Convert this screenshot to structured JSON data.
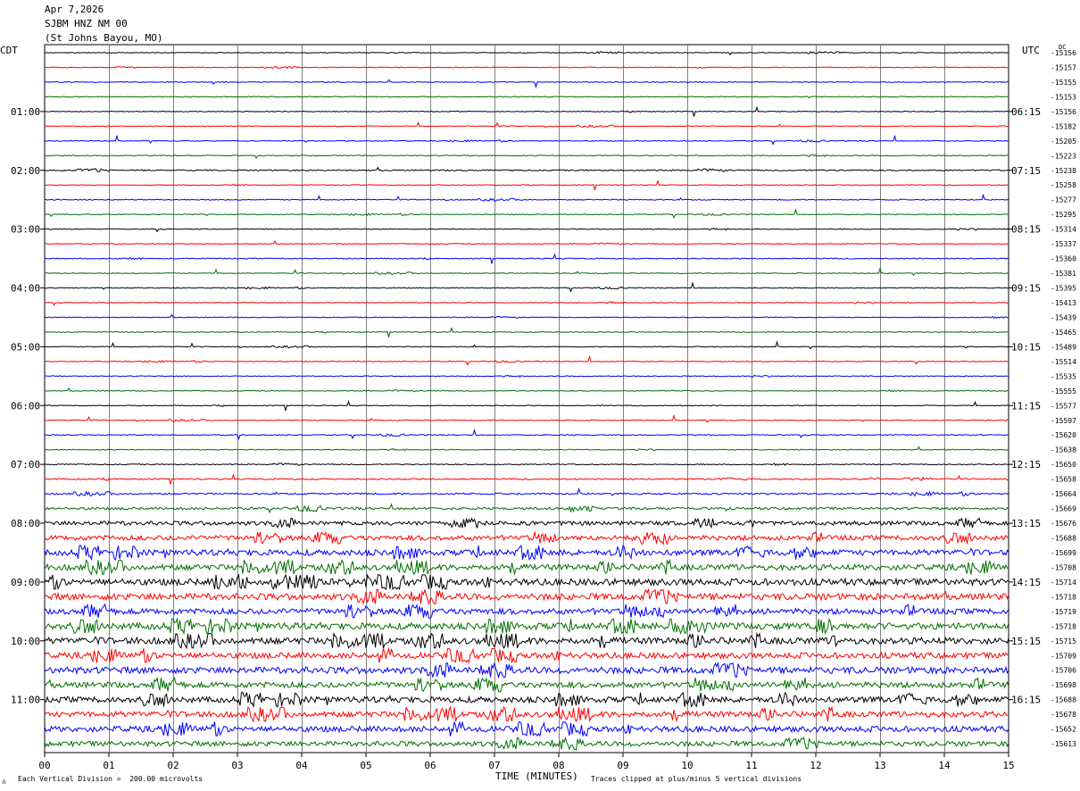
{
  "header": {
    "date": "Apr 7,2026",
    "station": "SJBM HNZ NM 00",
    "location": "(St Johns Bayou, MO)"
  },
  "left_axis_label": "CDT",
  "right_axis_label": "UTC",
  "dc_label": "DC",
  "footer": {
    "scale_note": "Each Vertical Division =  200.00 microvolts",
    "xlabel": "TIME (MINUTES)",
    "clip_note": "Traces clipped at plus/minus 5 vertical divisions"
  },
  "colors": {
    "trace_cycle": [
      "#000000",
      "#ff0000",
      "#0000ff",
      "#007000"
    ],
    "gridline": "#808080"
  },
  "chart_data": {
    "type": "line",
    "title": "",
    "xlabel": "TIME (MINUTES)",
    "x_ticks": [
      "00",
      "01",
      "02",
      "03",
      "04",
      "05",
      "06",
      "07",
      "08",
      "09",
      "10",
      "11",
      "12",
      "13",
      "14",
      "15"
    ],
    "xlim": [
      0,
      15
    ],
    "rows_per_hour": 4,
    "trace_count": 48,
    "left_hour_labels": [
      "01:00",
      "02:00",
      "03:00",
      "04:00",
      "05:00",
      "06:00",
      "07:00",
      "08:00",
      "09:00",
      "10:00",
      "11:00"
    ],
    "right_hour_labels": [
      "06:15",
      "07:15",
      "08:15",
      "09:15",
      "10:15",
      "11:15",
      "12:15",
      "13:15",
      "14:15",
      "15:15",
      "16:15"
    ],
    "dc_offsets": [
      "-15156",
      "-15157",
      "-15155",
      "-15153",
      "-15156",
      "-15182",
      "-15205",
      "-15223",
      "-15238",
      "-15258",
      "-15277",
      "-15295",
      "-15314",
      "-15337",
      "-15360",
      "-15381",
      "-15395",
      "-15413",
      "-15439",
      "-15465",
      "-15489",
      "-15514",
      "-15535",
      "-15555",
      "-15577",
      "-15597",
      "-15620",
      "-15638",
      "-15650",
      "-15658",
      "-15664",
      "-15669",
      "-15676",
      "-15688",
      "-15699",
      "-15708",
      "-15714",
      "-15718",
      "-15719",
      "-15718",
      "-15715",
      "-15709",
      "-15706",
      "-15698",
      "-15688",
      "-15678",
      "-15652",
      "-15613"
    ],
    "noise_level": [
      0.5,
      0.5,
      0.5,
      0.5,
      0.5,
      0.5,
      0.5,
      0.6,
      0.8,
      0.5,
      0.6,
      0.5,
      0.5,
      0.5,
      0.6,
      0.5,
      0.5,
      0.5,
      0.5,
      0.5,
      0.5,
      0.5,
      0.5,
      0.5,
      0.5,
      0.5,
      0.6,
      0.5,
      0.6,
      0.8,
      1.0,
      1.5,
      2.5,
      3.0,
      3.5,
      3.5,
      4.0,
      4.0,
      3.5,
      4.0,
      4.0,
      3.5,
      4.0,
      3.5,
      3.5,
      3.5,
      3.5,
      3.0
    ]
  }
}
